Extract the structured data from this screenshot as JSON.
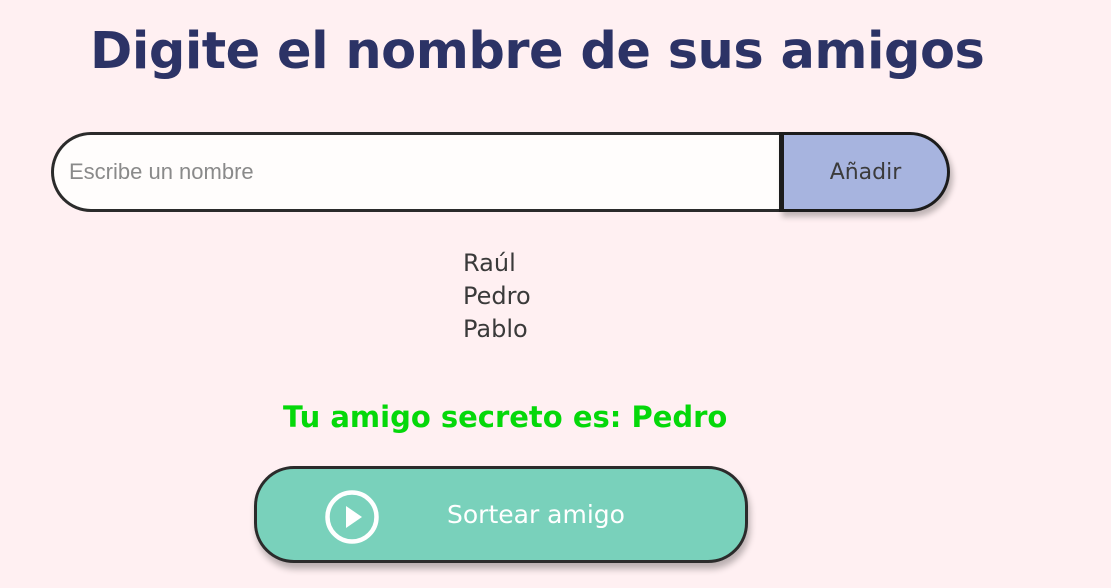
{
  "header": {
    "title": "Digite el nombre de sus amigos"
  },
  "input_section": {
    "placeholder": "Escribe un nombre",
    "value": "",
    "add_label": "Añadir"
  },
  "friends": {
    "items": [
      "Raúl",
      "Pedro",
      "Pablo"
    ]
  },
  "result": {
    "text": "Tu amigo secreto es: Pedro",
    "color": "#05d80a"
  },
  "draw_button": {
    "label": "Sortear amigo",
    "icon": "play-circle-icon"
  },
  "colors": {
    "background": "#fff0f2",
    "title": "#2c3366",
    "add_button": "#a7b4df",
    "draw_button": "#79d1bb"
  }
}
